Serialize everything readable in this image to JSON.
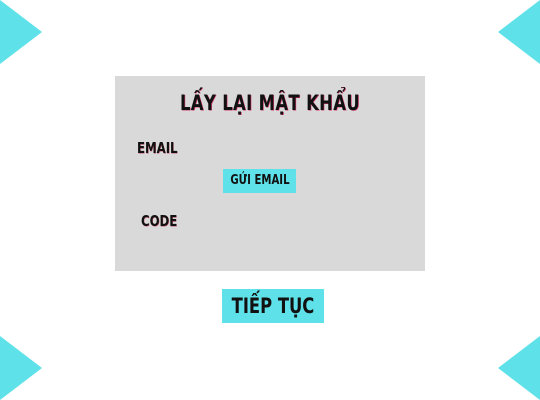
{
  "title": "LẤY LẠI MẬT KHẨU",
  "form": {
    "email_label": "EMAIL",
    "send_email_button": "GỬI EMAIL",
    "code_label": "CODE"
  },
  "continue_button": "TIẾP TỤC",
  "colors": {
    "accent": "#5ee1e8",
    "panel": "#d9d9d9",
    "background": "#ffffff",
    "text": "#111111"
  }
}
